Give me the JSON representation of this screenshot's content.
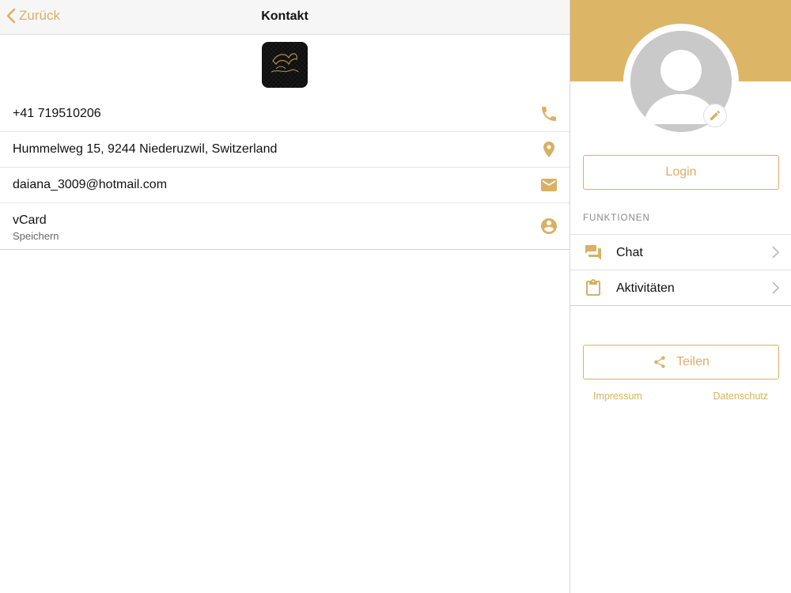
{
  "navbar": {
    "back_label": "Zurück",
    "title": "Kontakt"
  },
  "contacts": [
    {
      "text": "+41 719510206",
      "icon": "phone-icon"
    },
    {
      "text": "Hummelweg 15, 9244 Niederuzwil, Switzerland",
      "icon": "map-pin-icon"
    },
    {
      "text": "daiana_3009@hotmail.com",
      "icon": "mail-icon"
    },
    {
      "text": "vCard",
      "subtext": "Speichern",
      "icon": "account-circle-icon"
    }
  ],
  "sidebar": {
    "login_label": "Login",
    "section_title": "FUNKTIONEN",
    "menu": [
      {
        "label": "Chat",
        "icon": "chat-icon"
      },
      {
        "label": "Aktivitäten",
        "icon": "clipboard-icon"
      }
    ],
    "share_label": "Teilen",
    "impressum_label": "Impressum",
    "datenschutz_label": "Datenschutz"
  },
  "colors": {
    "accent": "#d9b064",
    "hero": "#dcb567",
    "avatar": "#c9c9c9"
  }
}
